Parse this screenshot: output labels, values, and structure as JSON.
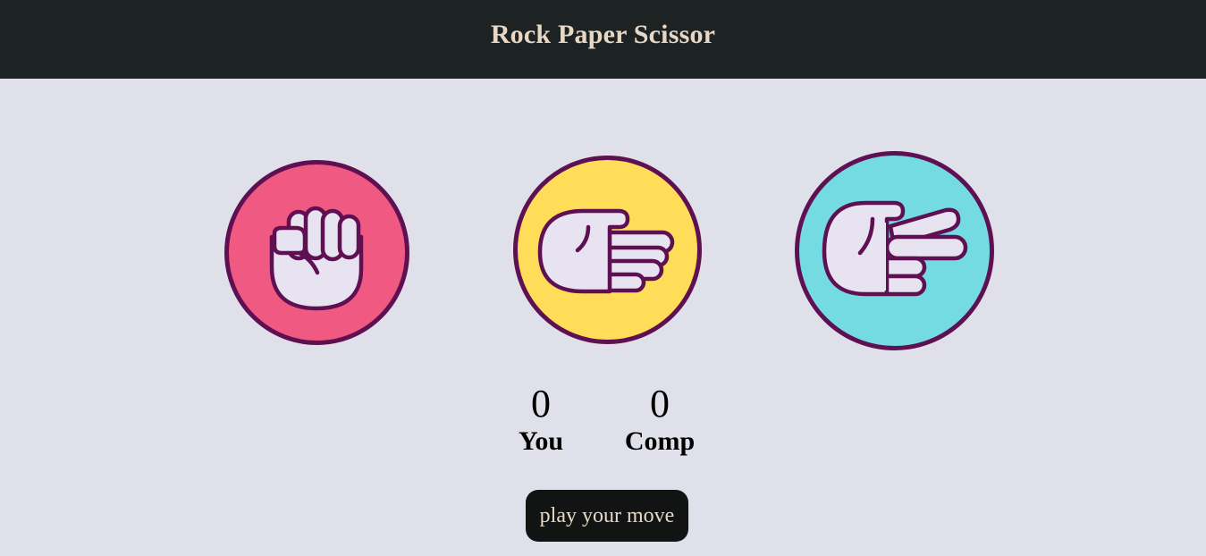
{
  "header": {
    "title": "Rock Paper Scissor"
  },
  "choices": [
    {
      "name": "rock",
      "icon": "rock-fist-icon",
      "bg_color": "#f05a82"
    },
    {
      "name": "paper",
      "icon": "paper-hand-icon",
      "bg_color": "#ffdd58"
    },
    {
      "name": "scissors",
      "icon": "scissors-hand-icon",
      "bg_color": "#75dbe2"
    }
  ],
  "colors": {
    "header_bg": "#1d2222",
    "page_bg": "#e0e0eb",
    "outline": "#5e1052",
    "hand_fill": "#e8e3f0",
    "title_text": "#e7d7c5"
  },
  "scoreboard": {
    "user": {
      "score": "0",
      "label": "You"
    },
    "comp": {
      "score": "0",
      "label": "Comp"
    }
  },
  "message": {
    "text": "play your move"
  }
}
